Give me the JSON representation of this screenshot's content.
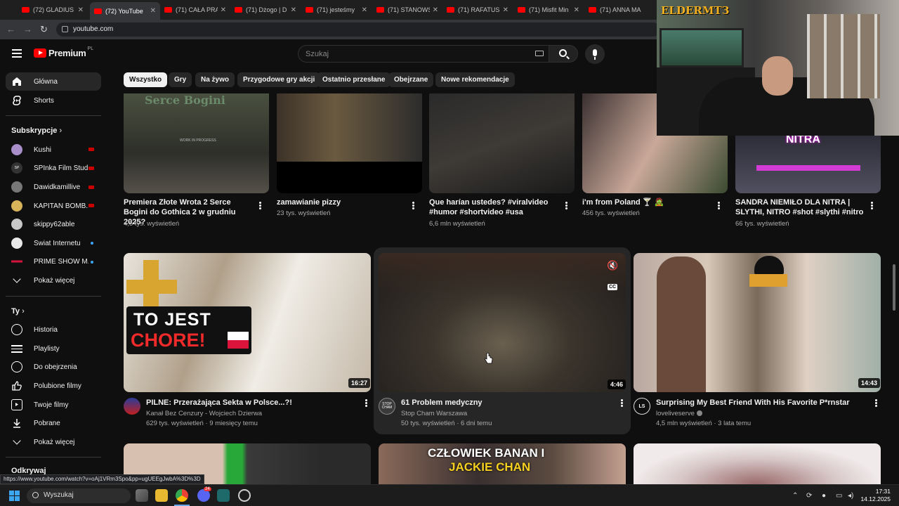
{
  "browser": {
    "tabs": [
      {
        "title": "(72) GLADIUS"
      },
      {
        "title": "(72) YouTube"
      },
      {
        "title": "(71) CAŁA PRA"
      },
      {
        "title": "(71) Dżogo | D"
      },
      {
        "title": "(71) jesteśmy"
      },
      {
        "title": "(71) STANOWS"
      },
      {
        "title": "(71) RAFATUS"
      },
      {
        "title": "(71) Misfit Min"
      },
      {
        "title": "(71) ANNA MA"
      }
    ],
    "url": "youtube.com",
    "status_url": "https://www.youtube.com/watch?v=oAj1VRm3Spo&pp=ugUEEgJwbA%3D%3D"
  },
  "header": {
    "logo": "Premium",
    "region": "PL",
    "search_placeholder": "Szukaj"
  },
  "chips": [
    "Wszystko",
    "Gry",
    "Na żywo",
    "Przygodowe gry akcji",
    "Ostatnio przesłane",
    "Obejrzane",
    "Nowe rekomendacje"
  ],
  "sidebar": {
    "main": [
      {
        "label": "Główna",
        "icon": "home-icon"
      },
      {
        "label": "Shorts",
        "icon": "shorts-icon"
      }
    ],
    "subs_heading": "Subskrypcje",
    "subscriptions": [
      {
        "name": "Kushi",
        "status": "live"
      },
      {
        "name": "SPInka Film Stud...",
        "status": "live"
      },
      {
        "name": "Dawidkamillive",
        "status": "live"
      },
      {
        "name": "KAPITAN BOMB...",
        "status": "live"
      },
      {
        "name": "skippy62able",
        "status": ""
      },
      {
        "name": "Świat Internetu",
        "status": "new"
      },
      {
        "name": "PRIME SHOW M...",
        "status": "new"
      }
    ],
    "show_more": "Pokaż więcej",
    "you_heading": "Ty",
    "you_items": [
      {
        "label": "Historia",
        "icon": "history-icon"
      },
      {
        "label": "Playlisty",
        "icon": "playlist-icon"
      },
      {
        "label": "Do obejrzenia",
        "icon": "watch-later-icon"
      },
      {
        "label": "Polubione filmy",
        "icon": "thumbs-up-icon"
      },
      {
        "label": "Twoje filmy",
        "icon": "your-videos-icon"
      },
      {
        "label": "Pobrane",
        "icon": "download-icon"
      }
    ],
    "show_more_2": "Pokaż więcej",
    "explore_heading": "Odkrywaj"
  },
  "row1": [
    {
      "title": "Premiera Złote Wrota 2 Serce Bogini do Gothica 2 w grudniu 2025?",
      "meta": "4,5 tys. wyświetleń",
      "thumb_text": "Serce Bogini",
      "thumb_sub": "WORK IN PROGRESS"
    },
    {
      "title": "zamawianie pizzy",
      "meta": "23 tys. wyświetleń"
    },
    {
      "title": "Que harían ustedes? #viralvideo #humor #shortvideo #usa",
      "meta": "6,6 mln wyświetleń"
    },
    {
      "title": "i'm from Poland 🍸 🧟",
      "meta": "456 tys. wyświetleń"
    },
    {
      "title": "SANDRA NIEMIŁO DLA NITRA | SLYTHI, NITRO #shot #slythi #nitro",
      "meta": "66 tys. wyświetleń",
      "thumb_text": "NITRA"
    }
  ],
  "row2": [
    {
      "title": "PILNE: Przerażająca Sekta w Polsce...?!",
      "channel": "Kanał Bez Cenzury - Wojciech Dzierwa",
      "meta": "629 tys. wyświetleń · 9 miesięcy temu",
      "duration": "16:27",
      "overlay1": "TO JEST",
      "overlay2": "CHORE!"
    },
    {
      "title": "61 Problem medyczny",
      "channel": "Stop Cham Warszawa",
      "meta": "50 tys. wyświetleń · 6 dni temu",
      "duration": "4:46",
      "cc": "CC",
      "avatar_text": "STOP CHAM"
    },
    {
      "title": "Surprising My Best Friend With His Favorite P*rnstar",
      "channel": "loveliveserve",
      "meta": "4,5 mln wyświetleń · 3 lata temu",
      "duration": "14:43",
      "avatar_text": "LS"
    }
  ],
  "row3": [
    {
      "thumb_text1": "CZŁOWIEK BANAN I",
      "thumb_text2": "JACKIE CHAN"
    }
  ],
  "webcam": {
    "overlay": "ELDERМТЗ"
  },
  "taskbar": {
    "search": "Wyszukaj",
    "time": "17:31",
    "date": "14.12.2025",
    "discord_badge": "24"
  },
  "colors": {
    "accent": "#ff0000",
    "bg": "#0f0f0f",
    "chip": "#272727"
  }
}
